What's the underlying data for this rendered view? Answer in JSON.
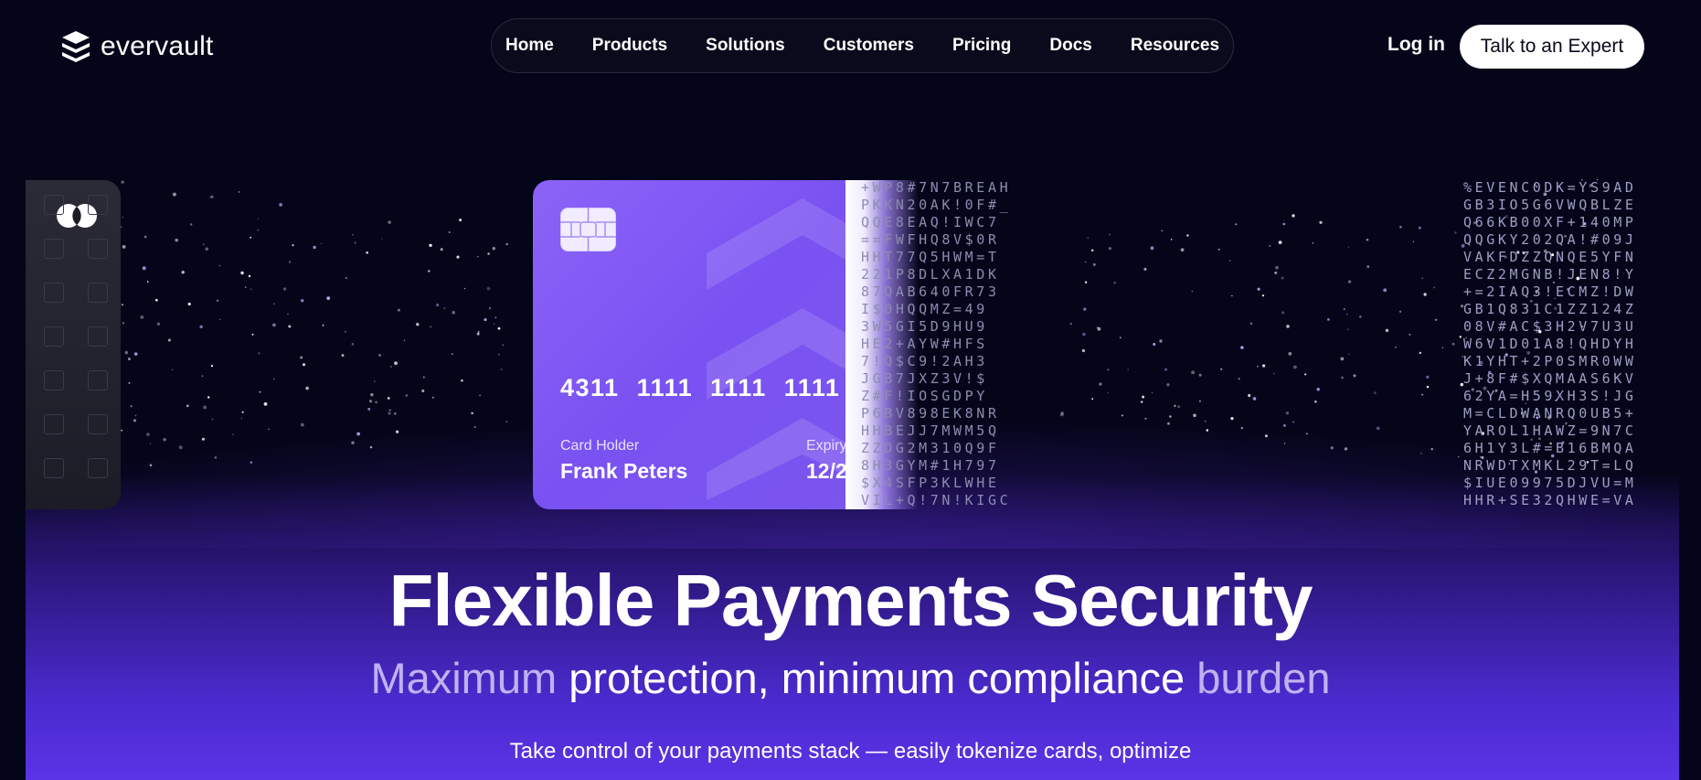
{
  "brand": {
    "name": "evervault",
    "logo_icon": "evervault-logo-icon"
  },
  "nav": {
    "items": [
      {
        "label": "Home"
      },
      {
        "label": "Products"
      },
      {
        "label": "Solutions"
      },
      {
        "label": "Customers"
      },
      {
        "label": "Pricing"
      },
      {
        "label": "Docs"
      },
      {
        "label": "Resources"
      }
    ]
  },
  "header": {
    "login_label": "Log in",
    "cta_label": "Talk to an Expert"
  },
  "card": {
    "number": "4311 1111 1111 1111",
    "holder_label": "Card Holder",
    "holder_name": "Frank Peters",
    "expiry_label": "Expiry",
    "expiry_value": "12/2",
    "chip_icon": "card-chip-icon",
    "network_icon": "card-network-icon"
  },
  "cipher_mid": [
    "+WP8#7N7BREAH",
    "PKKN20AK!0F#_",
    "QQE8EAQ!IWC7",
    "==FWFHQ8V$0R",
    "HHT77Q5HWM=T",
    "221P8DLXA1DK",
    "87QAB640FR73",
    "I$0HQQMZ=49",
    "3W5GI5D9HU9",
    "HE2+AYW#HFS",
    "7!Q$C9!2AH3",
    "JGB7JXZ3V!$",
    "Z#F!IOSGDPY",
    "P6BV898EK8NR",
    "HHBEJJ7MWM5Q",
    "ZZDG2M310Q9F",
    "8H3GYM#1H797",
    "$X4SFP3KLWHE",
    "VIL+Q!7N!KIGC"
  ],
  "cipher_right": [
    "%EVENC0DK=YS9AD",
    "GB3IO5G6VWQBLZE",
    "Q66KB00XF+140MP",
    "QQGKY202QA!#09J",
    "VAKFDZZQNQE5YFN",
    "ECZ2MGNB!JEN8!Y",
    "+=2IAQ3!ECMZ!DW",
    "GB1Q831C1ZZ124Z",
    "08V#AC$3H2V7U3U",
    "W6V1D01A8!QHDYH",
    "K1YHT+2P0SMR0WW",
    "J+8F#$XQMAAS6KV",
    "62YA=H59XH3S!JG",
    "M=CLDWANRQ0UB5+",
    "YAROL1HAWZ=9N7C",
    "6H1Y3L#=B16BMQA",
    "NRWDTXMKL29T=LQ",
    "$IUE09975DJVU=M",
    "HHR+SE32QHWE=VA"
  ],
  "hero": {
    "headline": "Flexible Payments Security",
    "subhead_part1": "Maximum",
    "subhead_part2": "protection, minimum compliance",
    "subhead_part3": "burden",
    "body": "Take control of your payments stack — easily tokenize cards, optimize"
  },
  "colors": {
    "background": "#05051a",
    "accent": "#7a52f2",
    "card": "#8c63f7"
  }
}
